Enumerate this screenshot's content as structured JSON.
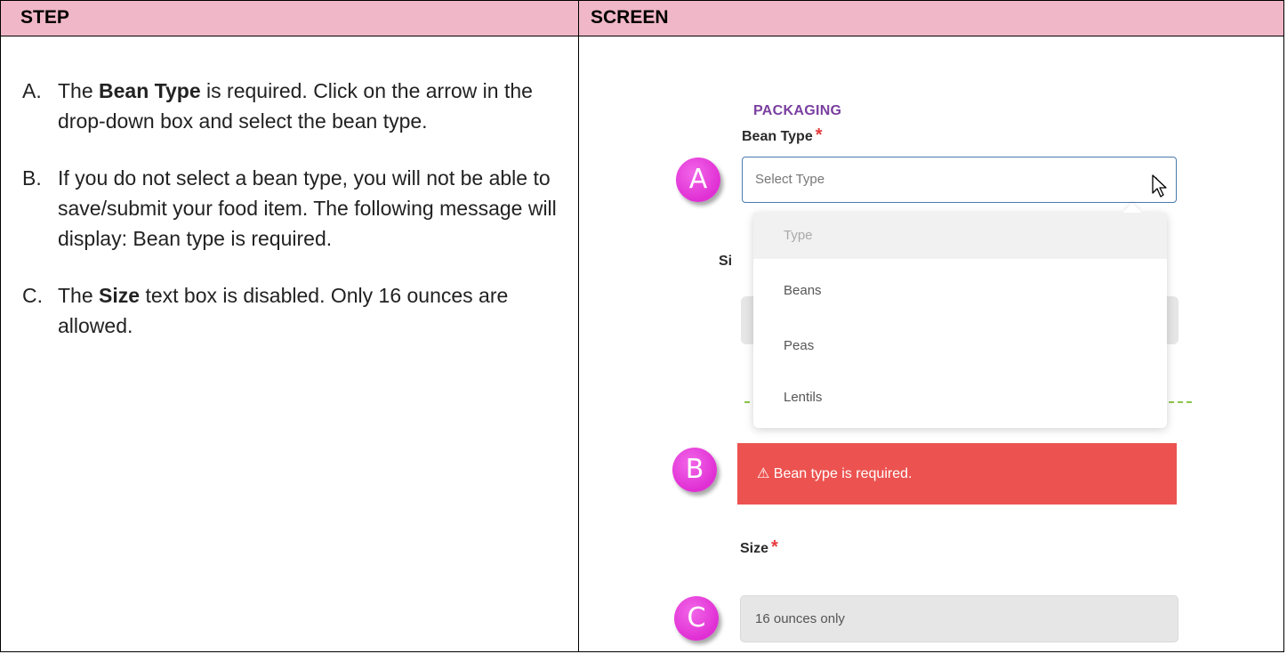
{
  "header": {
    "step": "STEP",
    "screen": "SCREEN"
  },
  "steps": [
    {
      "letter": "A.",
      "pre": "The ",
      "bold": "Bean Type",
      "post": " is required.  Click on the arrow in the drop-down box and select the bean type."
    },
    {
      "letter": "B.",
      "pre": "If you do not select a bean type, you will not be able to save/submit your food item.  The following message will display:  Bean type is required.",
      "bold": "",
      "post": ""
    },
    {
      "letter": "C.",
      "pre": "The ",
      "bold": "Size",
      "post": " text box is disabled.  Only 16 ounces are allowed."
    }
  ],
  "screen": {
    "section_title": "PACKAGING",
    "bean_type_label": "Bean Type",
    "required_mark": "*",
    "select_placeholder": "Select Type",
    "dropdown_options": [
      "Type",
      "Beans",
      "Peas",
      "Lentils"
    ],
    "hidden_label_fragment": "Si",
    "alert_text": "⚠ Bean type is required.",
    "size_label": "Size",
    "size_value": "16 ounces only",
    "badges": [
      "A",
      "B",
      "C"
    ],
    "colors": {
      "header_bg": "#f0b7c8",
      "badge": "#e02fd4",
      "alert_bg": "#ec5350",
      "section_title": "#7a3fa0",
      "required": "#e63b3b"
    }
  }
}
